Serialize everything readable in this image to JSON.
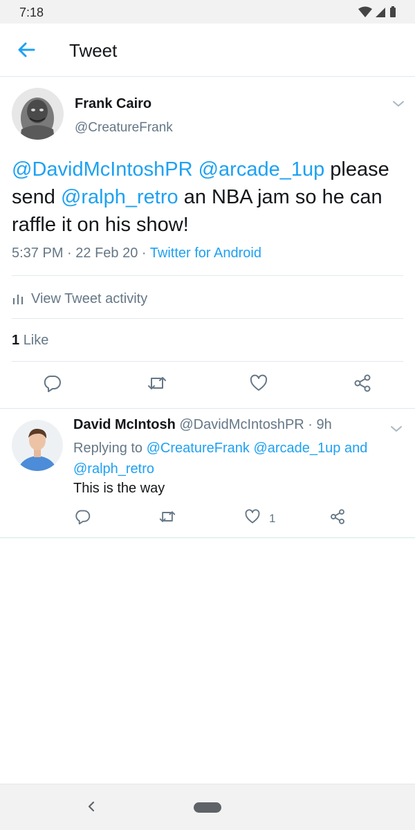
{
  "status_bar": {
    "time": "7:18",
    "icons": [
      "wifi-icon",
      "signal-icon",
      "battery-icon"
    ]
  },
  "header": {
    "title": "Tweet"
  },
  "tweet": {
    "author_name": "Frank Cairo",
    "author_handle": "@CreatureFrank",
    "text_segments": [
      {
        "text": "@DavidMcIntoshPR",
        "mention": true
      },
      {
        "text": " ",
        "mention": false
      },
      {
        "text": "@arcade_1up",
        "mention": true
      },
      {
        "text": " please send ",
        "mention": false
      },
      {
        "text": "@ralph_retro",
        "mention": true
      },
      {
        "text": " an NBA jam so he can raffle it on his show!",
        "mention": false
      }
    ],
    "time": "5:37 PM",
    "date": "22 Feb 20",
    "source": "Twitter for Android",
    "separator": "·",
    "activity_label": "View Tweet activity",
    "like_count": "1",
    "like_label": "Like"
  },
  "reply": {
    "author_name": "David McIntosh",
    "author_handle": "@DavidMcIntoshPR",
    "age": "9h",
    "separator": "·",
    "replying_prefix": "Replying to ",
    "replying_to": [
      "@CreatureFrank",
      "@arcade_1up",
      "@ralph_retro"
    ],
    "replying_joiner": " and ",
    "text": "This is the way",
    "like_count": "1"
  },
  "colors": {
    "accent": "#1da1f2",
    "secondary_text": "#657786",
    "primary_text": "#14171a",
    "divider": "#e1e8ed"
  }
}
